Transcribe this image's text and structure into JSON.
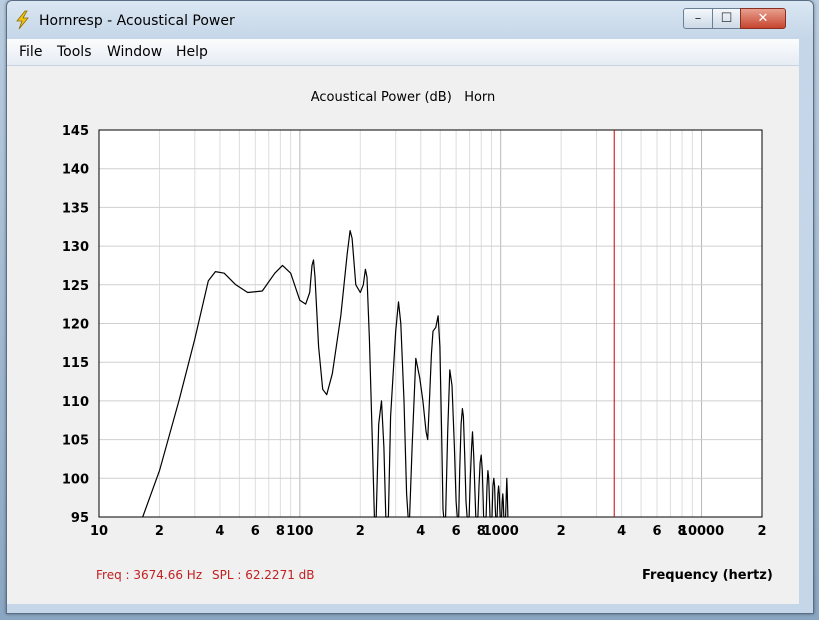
{
  "window": {
    "title": "Hornresp - Acoustical Power",
    "controls": {
      "minimize": "–",
      "maximize": "☐",
      "close": "✕"
    }
  },
  "menu": {
    "items": [
      "File",
      "Tools",
      "Window",
      "Help"
    ]
  },
  "status": {
    "freq": "Freq : 3674.66 Hz",
    "spl": "SPL : 62.2271 dB"
  },
  "chart_data": {
    "type": "line",
    "title": "Acoustical Power (dB)   Horn",
    "xlabel": "Frequency (hertz)",
    "ylabel": "",
    "x_scale": "log",
    "xlim": [
      10,
      20000
    ],
    "ylim": [
      95,
      145
    ],
    "y_ticks": [
      95,
      100,
      105,
      110,
      115,
      120,
      125,
      130,
      135,
      140,
      145
    ],
    "x_tick_labels": [
      {
        "x": 10,
        "label": "10"
      },
      {
        "x": 20,
        "label": "2"
      },
      {
        "x": 40,
        "label": "4"
      },
      {
        "x": 60,
        "label": "6"
      },
      {
        "x": 80,
        "label": "8"
      },
      {
        "x": 100,
        "label": "100"
      },
      {
        "x": 200,
        "label": "2"
      },
      {
        "x": 400,
        "label": "4"
      },
      {
        "x": 600,
        "label": "6"
      },
      {
        "x": 800,
        "label": "8"
      },
      {
        "x": 1000,
        "label": "1000"
      },
      {
        "x": 2000,
        "label": "2"
      },
      {
        "x": 4000,
        "label": "4"
      },
      {
        "x": 6000,
        "label": "6"
      },
      {
        "x": 8000,
        "label": "8"
      },
      {
        "x": 10000,
        "label": "10000"
      },
      {
        "x": 20000,
        "label": "2"
      }
    ],
    "grid": true,
    "cursor_x": 3674.66,
    "cursor_color": "#cc0000",
    "series": [
      {
        "color": "#000000",
        "points": [
          [
            16.5,
            95
          ],
          [
            20,
            101
          ],
          [
            25,
            110
          ],
          [
            30,
            118
          ],
          [
            35,
            125.5
          ],
          [
            38,
            126.7
          ],
          [
            42,
            126.5
          ],
          [
            48,
            125
          ],
          [
            55,
            124
          ],
          [
            65,
            124.2
          ],
          [
            75,
            126.5
          ],
          [
            82,
            127.5
          ],
          [
            90,
            126.5
          ],
          [
            100,
            123
          ],
          [
            107,
            122.5
          ],
          [
            112,
            124
          ],
          [
            115,
            127.5
          ],
          [
            117,
            128.2
          ],
          [
            119,
            126
          ],
          [
            124,
            117
          ],
          [
            130,
            111.5
          ],
          [
            136,
            110.8
          ],
          [
            145,
            113.5
          ],
          [
            160,
            121
          ],
          [
            172,
            129
          ],
          [
            178,
            132
          ],
          [
            182,
            131
          ],
          [
            190,
            125
          ],
          [
            200,
            124
          ],
          [
            207,
            125
          ],
          [
            212,
            127
          ],
          [
            216,
            126
          ],
          [
            222,
            118
          ],
          [
            230,
            104
          ],
          [
            235,
            95
          ],
          [
            240,
            95
          ],
          [
            247,
            107
          ],
          [
            255,
            110
          ],
          [
            262,
            104
          ],
          [
            268,
            95
          ],
          [
            276,
            95
          ],
          [
            283,
            108
          ],
          [
            300,
            119
          ],
          [
            310,
            122.8
          ],
          [
            318,
            120
          ],
          [
            330,
            110
          ],
          [
            340,
            98
          ],
          [
            346,
            95
          ],
          [
            352,
            95
          ],
          [
            362,
            104
          ],
          [
            378,
            115.5
          ],
          [
            395,
            113
          ],
          [
            410,
            110
          ],
          [
            425,
            106
          ],
          [
            433,
            105
          ],
          [
            440,
            109
          ],
          [
            452,
            116
          ],
          [
            460,
            119
          ],
          [
            475,
            119.5
          ],
          [
            488,
            121
          ],
          [
            498,
            117
          ],
          [
            508,
            106
          ],
          [
            516,
            96
          ],
          [
            520,
            95
          ],
          [
            532,
            95
          ],
          [
            545,
            106
          ],
          [
            558,
            114
          ],
          [
            572,
            112
          ],
          [
            588,
            104
          ],
          [
            600,
            97
          ],
          [
            608,
            95
          ],
          [
            618,
            95
          ],
          [
            625,
            101
          ],
          [
            635,
            107
          ],
          [
            645,
            109
          ],
          [
            652,
            108
          ],
          [
            662,
            103
          ],
          [
            672,
            97
          ],
          [
            680,
            95
          ],
          [
            696,
            95
          ],
          [
            706,
            100
          ],
          [
            716,
            104
          ],
          [
            724,
            106
          ],
          [
            734,
            103
          ],
          [
            745,
            98
          ],
          [
            752,
            95
          ],
          [
            770,
            95
          ],
          [
            780,
            99
          ],
          [
            790,
            102
          ],
          [
            800,
            103
          ],
          [
            810,
            101
          ],
          [
            818,
            97
          ],
          [
            822,
            95
          ],
          [
            846,
            95
          ],
          [
            855,
            99
          ],
          [
            864,
            101
          ],
          [
            872,
            100
          ],
          [
            880,
            97
          ],
          [
            885,
            95
          ],
          [
            905,
            95
          ],
          [
            915,
            99
          ],
          [
            924,
            100
          ],
          [
            932,
            99
          ],
          [
            940,
            96
          ],
          [
            944,
            95
          ],
          [
            960,
            95
          ],
          [
            968,
            98
          ],
          [
            976,
            99
          ],
          [
            984,
            98
          ],
          [
            990,
            96
          ],
          [
            994,
            95
          ],
          [
            1010,
            95
          ],
          [
            1018,
            97
          ],
          [
            1024,
            98
          ],
          [
            1030,
            97
          ],
          [
            1036,
            95
          ],
          [
            1058,
            95
          ],
          [
            1066,
            98
          ],
          [
            1072,
            100
          ],
          [
            1078,
            98.5
          ],
          [
            1086,
            95
          ]
        ]
      }
    ]
  }
}
